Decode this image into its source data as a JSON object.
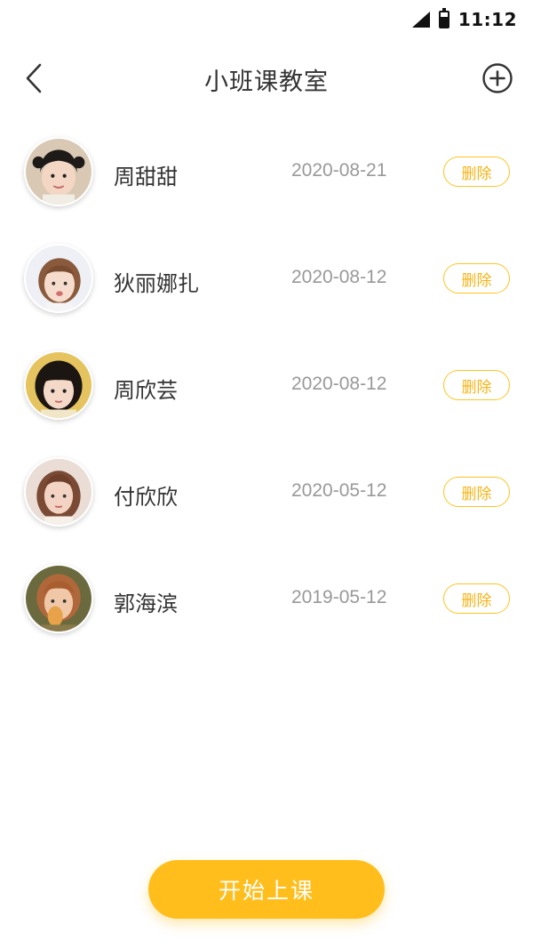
{
  "status_bar": {
    "time": "11:12"
  },
  "header": {
    "title": "小班课教室"
  },
  "students": [
    {
      "name": "周甜甜",
      "date": "2020-08-21",
      "delete_label": "删除"
    },
    {
      "name": "狄丽娜扎",
      "date": "2020-08-12",
      "delete_label": "删除"
    },
    {
      "name": "周欣芸",
      "date": "2020-08-12",
      "delete_label": "删除"
    },
    {
      "name": "付欣欣",
      "date": "2020-05-12",
      "delete_label": "删除"
    },
    {
      "name": "郭海滨",
      "date": "2019-05-12",
      "delete_label": "删除"
    }
  ],
  "footer": {
    "start_label": "开始上课"
  },
  "colors": {
    "accent": "#ffbe1c",
    "delete_border": "#ffc321"
  }
}
